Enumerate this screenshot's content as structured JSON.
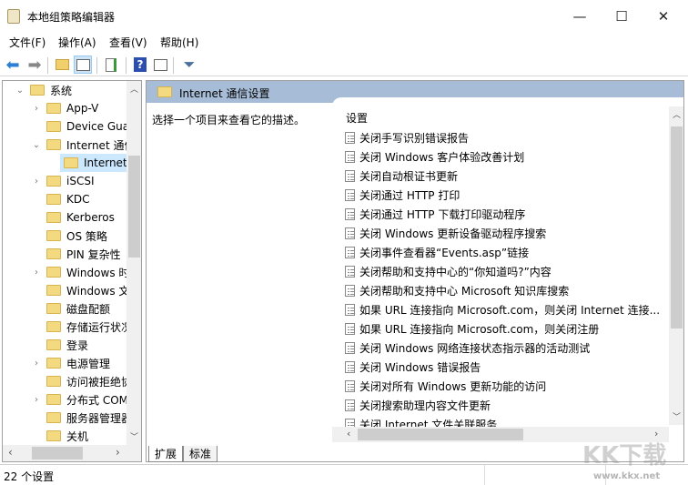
{
  "window": {
    "title": "本地组策略编辑器",
    "minimize": "—",
    "maximize": "☐",
    "close": "✕"
  },
  "menu": [
    "文件(F)",
    "操作(A)",
    "查看(V)",
    "帮助(H)"
  ],
  "toolbar": [
    "back-icon",
    "forward-icon",
    "up-folder-icon",
    "show-hide-tree-icon",
    "export-list-icon",
    "help-icon",
    "show-action-pane-icon",
    "filter-icon"
  ],
  "tree": {
    "items": [
      {
        "label": "系统",
        "expander": "⌄",
        "level": 0
      },
      {
        "label": "App-V",
        "expander": "›",
        "level": 1
      },
      {
        "label": "Device Gua",
        "expander": "",
        "level": 1
      },
      {
        "label": "Internet 通信",
        "expander": "⌄",
        "level": 1
      },
      {
        "label": "Internet",
        "expander": "",
        "level": 2,
        "selected": true
      },
      {
        "label": "iSCSI",
        "expander": "›",
        "level": 1
      },
      {
        "label": "KDC",
        "expander": "",
        "level": 1
      },
      {
        "label": "Kerberos",
        "expander": "",
        "level": 1
      },
      {
        "label": "OS 策略",
        "expander": "",
        "level": 1
      },
      {
        "label": "PIN 复杂性",
        "expander": "",
        "level": 1
      },
      {
        "label": "Windows 时",
        "expander": "›",
        "level": 1
      },
      {
        "label": "Windows 文",
        "expander": "",
        "level": 1
      },
      {
        "label": "磁盘配额",
        "expander": "",
        "level": 1
      },
      {
        "label": "存储运行状况",
        "expander": "",
        "level": 1
      },
      {
        "label": "登录",
        "expander": "",
        "level": 1
      },
      {
        "label": "电源管理",
        "expander": "›",
        "level": 1
      },
      {
        "label": "访问被拒绝协",
        "expander": "",
        "level": 1
      },
      {
        "label": "分布式 COM",
        "expander": "›",
        "level": 1
      },
      {
        "label": "服务器管理器",
        "expander": "",
        "level": 1
      },
      {
        "label": "关机",
        "expander": "",
        "level": 1
      }
    ]
  },
  "right": {
    "header": "Internet 通信设置",
    "description": "选择一个项目来查看它的描述。",
    "column": "设置",
    "settings": [
      "关闭手写识别错误报告",
      "关闭 Windows 客户体验改善计划",
      "关闭自动根证书更新",
      "关闭通过 HTTP 打印",
      "关闭通过 HTTP 下载打印驱动程序",
      "关闭 Windows 更新设备驱动程序搜索",
      "关闭事件查看器“Events.asp”链接",
      "关闭帮助和支持中心的“你知道吗?”内容",
      "关闭帮助和支持中心 Microsoft 知识库搜索",
      "如果 URL 连接指向 Microsoft.com，则关闭 Internet 连接...",
      "如果 URL 连接指向 Microsoft.com，则关闭注册",
      "关闭 Windows 网络连接状态指示器的活动测试",
      "关闭 Windows 错误报告",
      "关闭对所有 Windows 更新功能的访问",
      "关闭搜索助理内容文件更新",
      "关闭 Internet 文件关联服务"
    ]
  },
  "tabs": [
    "扩展",
    "标准"
  ],
  "status": "22 个设置",
  "watermark": {
    "logo": "KK下载",
    "url": "www.kkx.net"
  }
}
